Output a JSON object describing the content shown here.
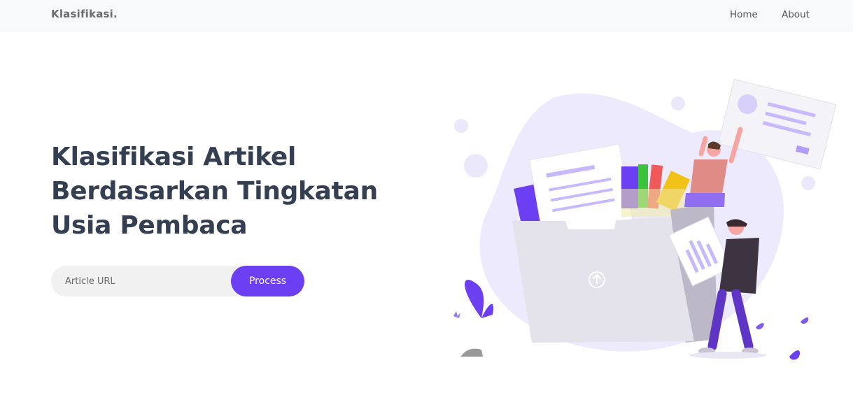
{
  "navbar": {
    "brand": "Klasifikasi.",
    "links": [
      {
        "label": "Home"
      },
      {
        "label": "About"
      }
    ]
  },
  "hero": {
    "headline_lines": [
      "Klasifikasi Artikel",
      "Berdasarkan Tingkatan",
      "Usia Pembaca"
    ]
  },
  "form": {
    "url_placeholder": "Article URL",
    "url_value": "",
    "submit_label": "Process"
  },
  "colors": {
    "accent": "#6d3ff2",
    "heading": "#343f52",
    "navbar_bg": "#f8f9fa",
    "blob": "#eeeafd"
  },
  "illustration": {
    "name": "folder-upload-people-illustration"
  }
}
